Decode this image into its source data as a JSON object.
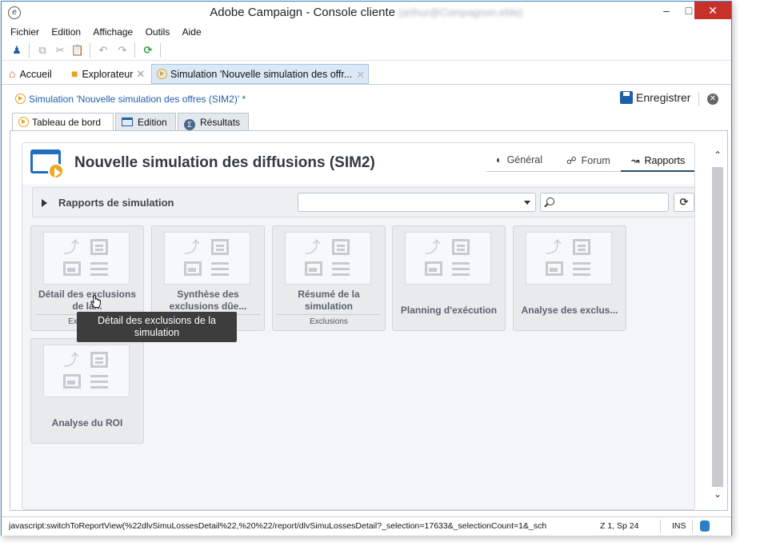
{
  "window": {
    "title": "Adobe Campaign - Console cliente",
    "title_user": "(arthur@Compagnon.eMe)",
    "minimize_glyph": "–",
    "maximize_glyph": "□",
    "close_glyph": "✕"
  },
  "menubar": [
    "Fichier",
    "Edition",
    "Affichage",
    "Outils",
    "Aide"
  ],
  "toolbar": {
    "icons": [
      "user-add-icon",
      "copy-icon",
      "cut-icon",
      "paste-icon",
      "undo-icon",
      "redo-icon",
      "refresh-icon"
    ]
  },
  "doctabs": {
    "home": "Accueil",
    "explorer": "Explorateur",
    "simulation": "Simulation 'Nouvelle simulation des offr..."
  },
  "crumb": {
    "path": "Simulation 'Nouvelle simulation des offres (SIM2)' *",
    "save_label": "Enregistrer"
  },
  "viewtabs": [
    "Tableau de bord",
    "Edition",
    "Résultats"
  ],
  "panel": {
    "title": "Nouvelle simulation des diffusions (SIM2)",
    "tabs": [
      "Général",
      "Forum",
      "Rapports"
    ],
    "active_tab": "Rapports"
  },
  "filter": {
    "label": "Rapports de simulation",
    "combo_value": "",
    "search_value": ""
  },
  "reports": [
    {
      "name": "Détail des exclusions de la...",
      "category": "Exclusions"
    },
    {
      "name": "Synthèse des exclusions dûe...",
      "category": ""
    },
    {
      "name": "Résumé de la simulation",
      "category": "Exclusions"
    },
    {
      "name": "Planning d'exécution",
      "category": ""
    },
    {
      "name": "Analyse des exclus...",
      "category": ""
    },
    {
      "name": "Analyse du ROI",
      "category": ""
    }
  ],
  "tooltip": "Détail des exclusions de la simulation",
  "statusbar": {
    "url": "javascript:switchToReportView(%22dlvSimuLossesDetail%22,%20%22/report/dlvSimuLossesDetail?_selection=17633&_selectionCount=1&_sch",
    "position": "Z 1, Sp 24",
    "mode": "INS"
  },
  "colors": {
    "accent": "#1f5fa8",
    "play_orange": "#f2a51d",
    "close_red": "#c7312a",
    "active_tab_line": "#2b4c75"
  }
}
